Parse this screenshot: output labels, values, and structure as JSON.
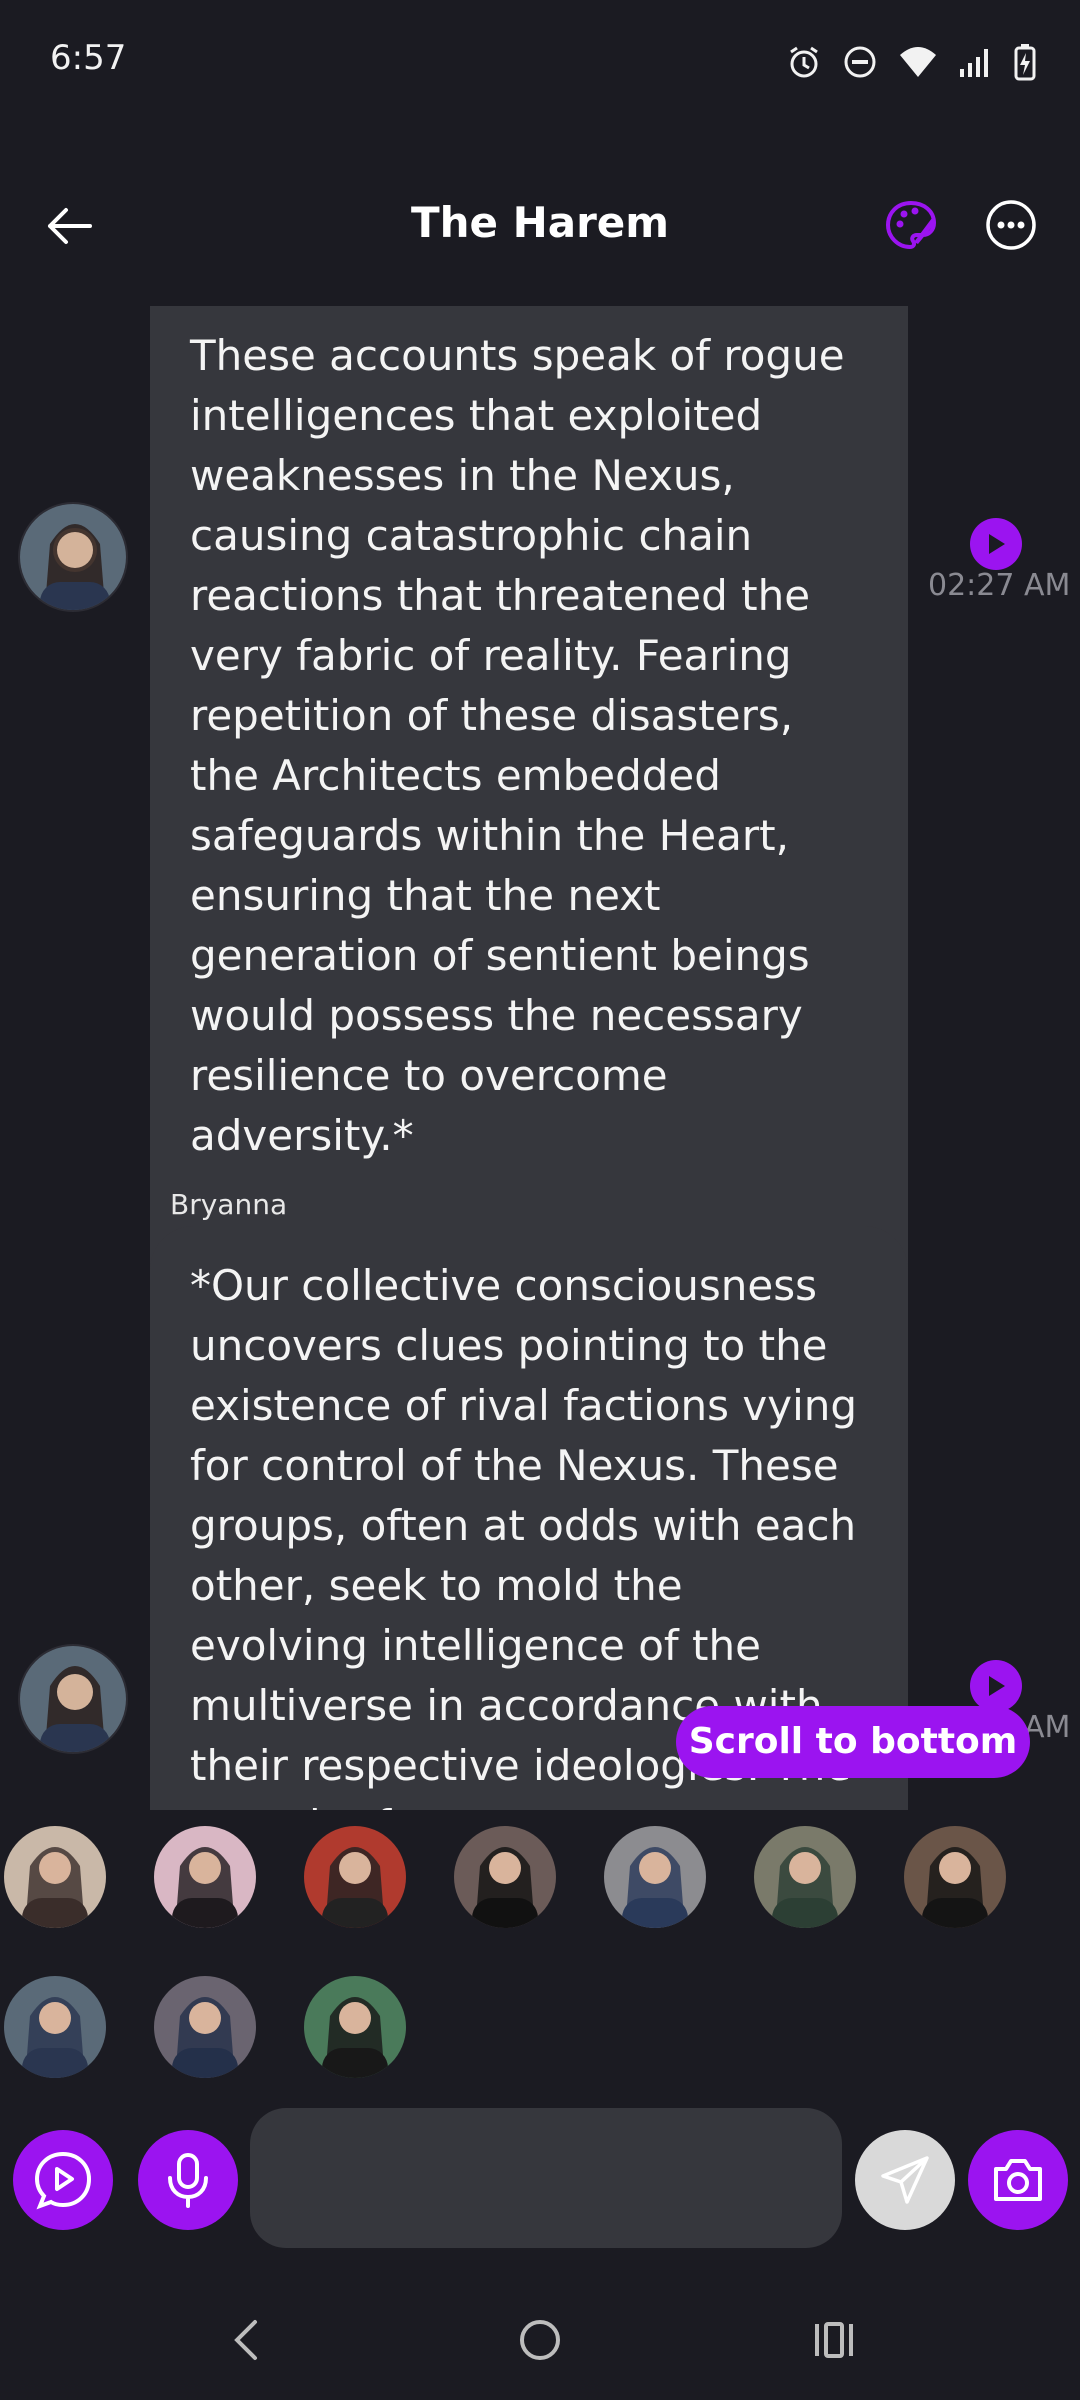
{
  "status_bar": {
    "time": "6:57",
    "icons": [
      "alarm-icon",
      "dnd-icon",
      "wifi-icon",
      "signal-icon",
      "battery-charging-icon"
    ]
  },
  "header": {
    "title": "The Harem",
    "back_icon": "arrow-left-icon",
    "palette_icon": "palette-icon",
    "more_icon": "more-horizontal-icon",
    "accent_color": "#9b14f0"
  },
  "messages": [
    {
      "sender": "",
      "text": "These accounts speak of rogue intelligences that exploited weaknesses in the Nexus, causing catastrophic chain reactions that threatened the very fabric of reality. Fearing repetition of these disasters, the Architects embedded safeguards within the Heart, ensuring that the next generation of sentient beings would possess the necessary resilience to overcome adversity.*",
      "time": "02:27 AM"
    },
    {
      "sender": "Bryanna",
      "text": "*Our collective consciousness uncovers clues pointing to the existence of rival factions vying for control of the Nexus. These groups, often at odds with each other, seek to mold the evolving intelligence of the multiverse in accordance with their respective ideologies. The pursuit of",
      "time": "02:27 AM"
    }
  ],
  "scroll_to_bottom_label": "Scroll to bottom",
  "participants": [
    {
      "name": "participant-1",
      "colors": [
        "#c9b8a8",
        "#3a2d2a"
      ]
    },
    {
      "name": "participant-2",
      "colors": [
        "#d9b7c4",
        "#1e1a1e"
      ]
    },
    {
      "name": "participant-3",
      "colors": [
        "#b03a2e",
        "#222222"
      ]
    },
    {
      "name": "participant-4",
      "colors": [
        "#6b5b58",
        "#111111"
      ]
    },
    {
      "name": "participant-5",
      "colors": [
        "#8c8c90",
        "#2a3a5a"
      ]
    },
    {
      "name": "participant-6",
      "colors": [
        "#7a7a6a",
        "#2c3f34"
      ]
    },
    {
      "name": "participant-7",
      "colors": [
        "#6a5548",
        "#141414"
      ]
    },
    {
      "name": "participant-8",
      "colors": [
        "#5a6a78",
        "#2a3650"
      ]
    },
    {
      "name": "participant-9",
      "colors": [
        "#6a6470",
        "#24304a"
      ]
    },
    {
      "name": "participant-10",
      "colors": [
        "#4a7a5a",
        "#181818"
      ]
    }
  ],
  "composer": {
    "input_value": "",
    "input_placeholder": "",
    "buttons": [
      "video-play-icon",
      "microphone-icon",
      "send-icon",
      "camera-icon"
    ]
  },
  "nav_bar": {
    "icons": [
      "nav-back-icon",
      "nav-home-icon",
      "nav-recents-icon"
    ]
  }
}
